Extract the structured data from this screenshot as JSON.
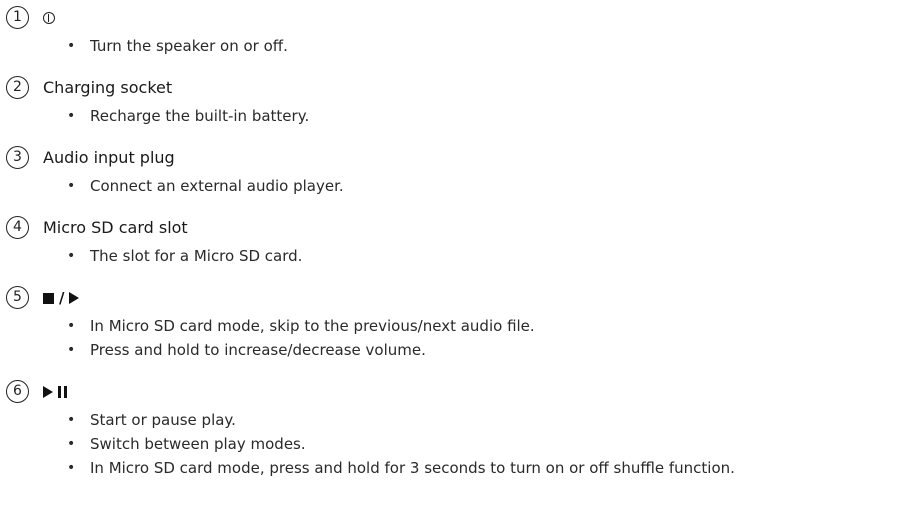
{
  "items": [
    {
      "number": "1",
      "symbol": "power-icon",
      "bullets": [
        "Turn the speaker on or off."
      ]
    },
    {
      "number": "2",
      "title": "Charging socket",
      "bullets": [
        "Recharge the built-in battery."
      ]
    },
    {
      "number": "3",
      "title": "Audio input plug",
      "bullets": [
        "Connect an external audio player."
      ]
    },
    {
      "number": "4",
      "title": "Micro SD card slot",
      "bullets": [
        "The slot for a Micro SD card."
      ]
    },
    {
      "number": "5",
      "symbol": "stop-icon / play-icon",
      "slash": "/",
      "bullets": [
        "In Micro SD card mode, skip to the previous/next audio file.",
        "Press and hold to increase/decrease volume."
      ]
    },
    {
      "number": "6",
      "symbol": "play-pause-icon",
      "bullets": [
        "Start or pause play.",
        "Switch between play modes.",
        "In Micro SD card mode, press and hold for 3 seconds to turn on or off shuffle function."
      ]
    }
  ],
  "bullet_glyph": "•"
}
